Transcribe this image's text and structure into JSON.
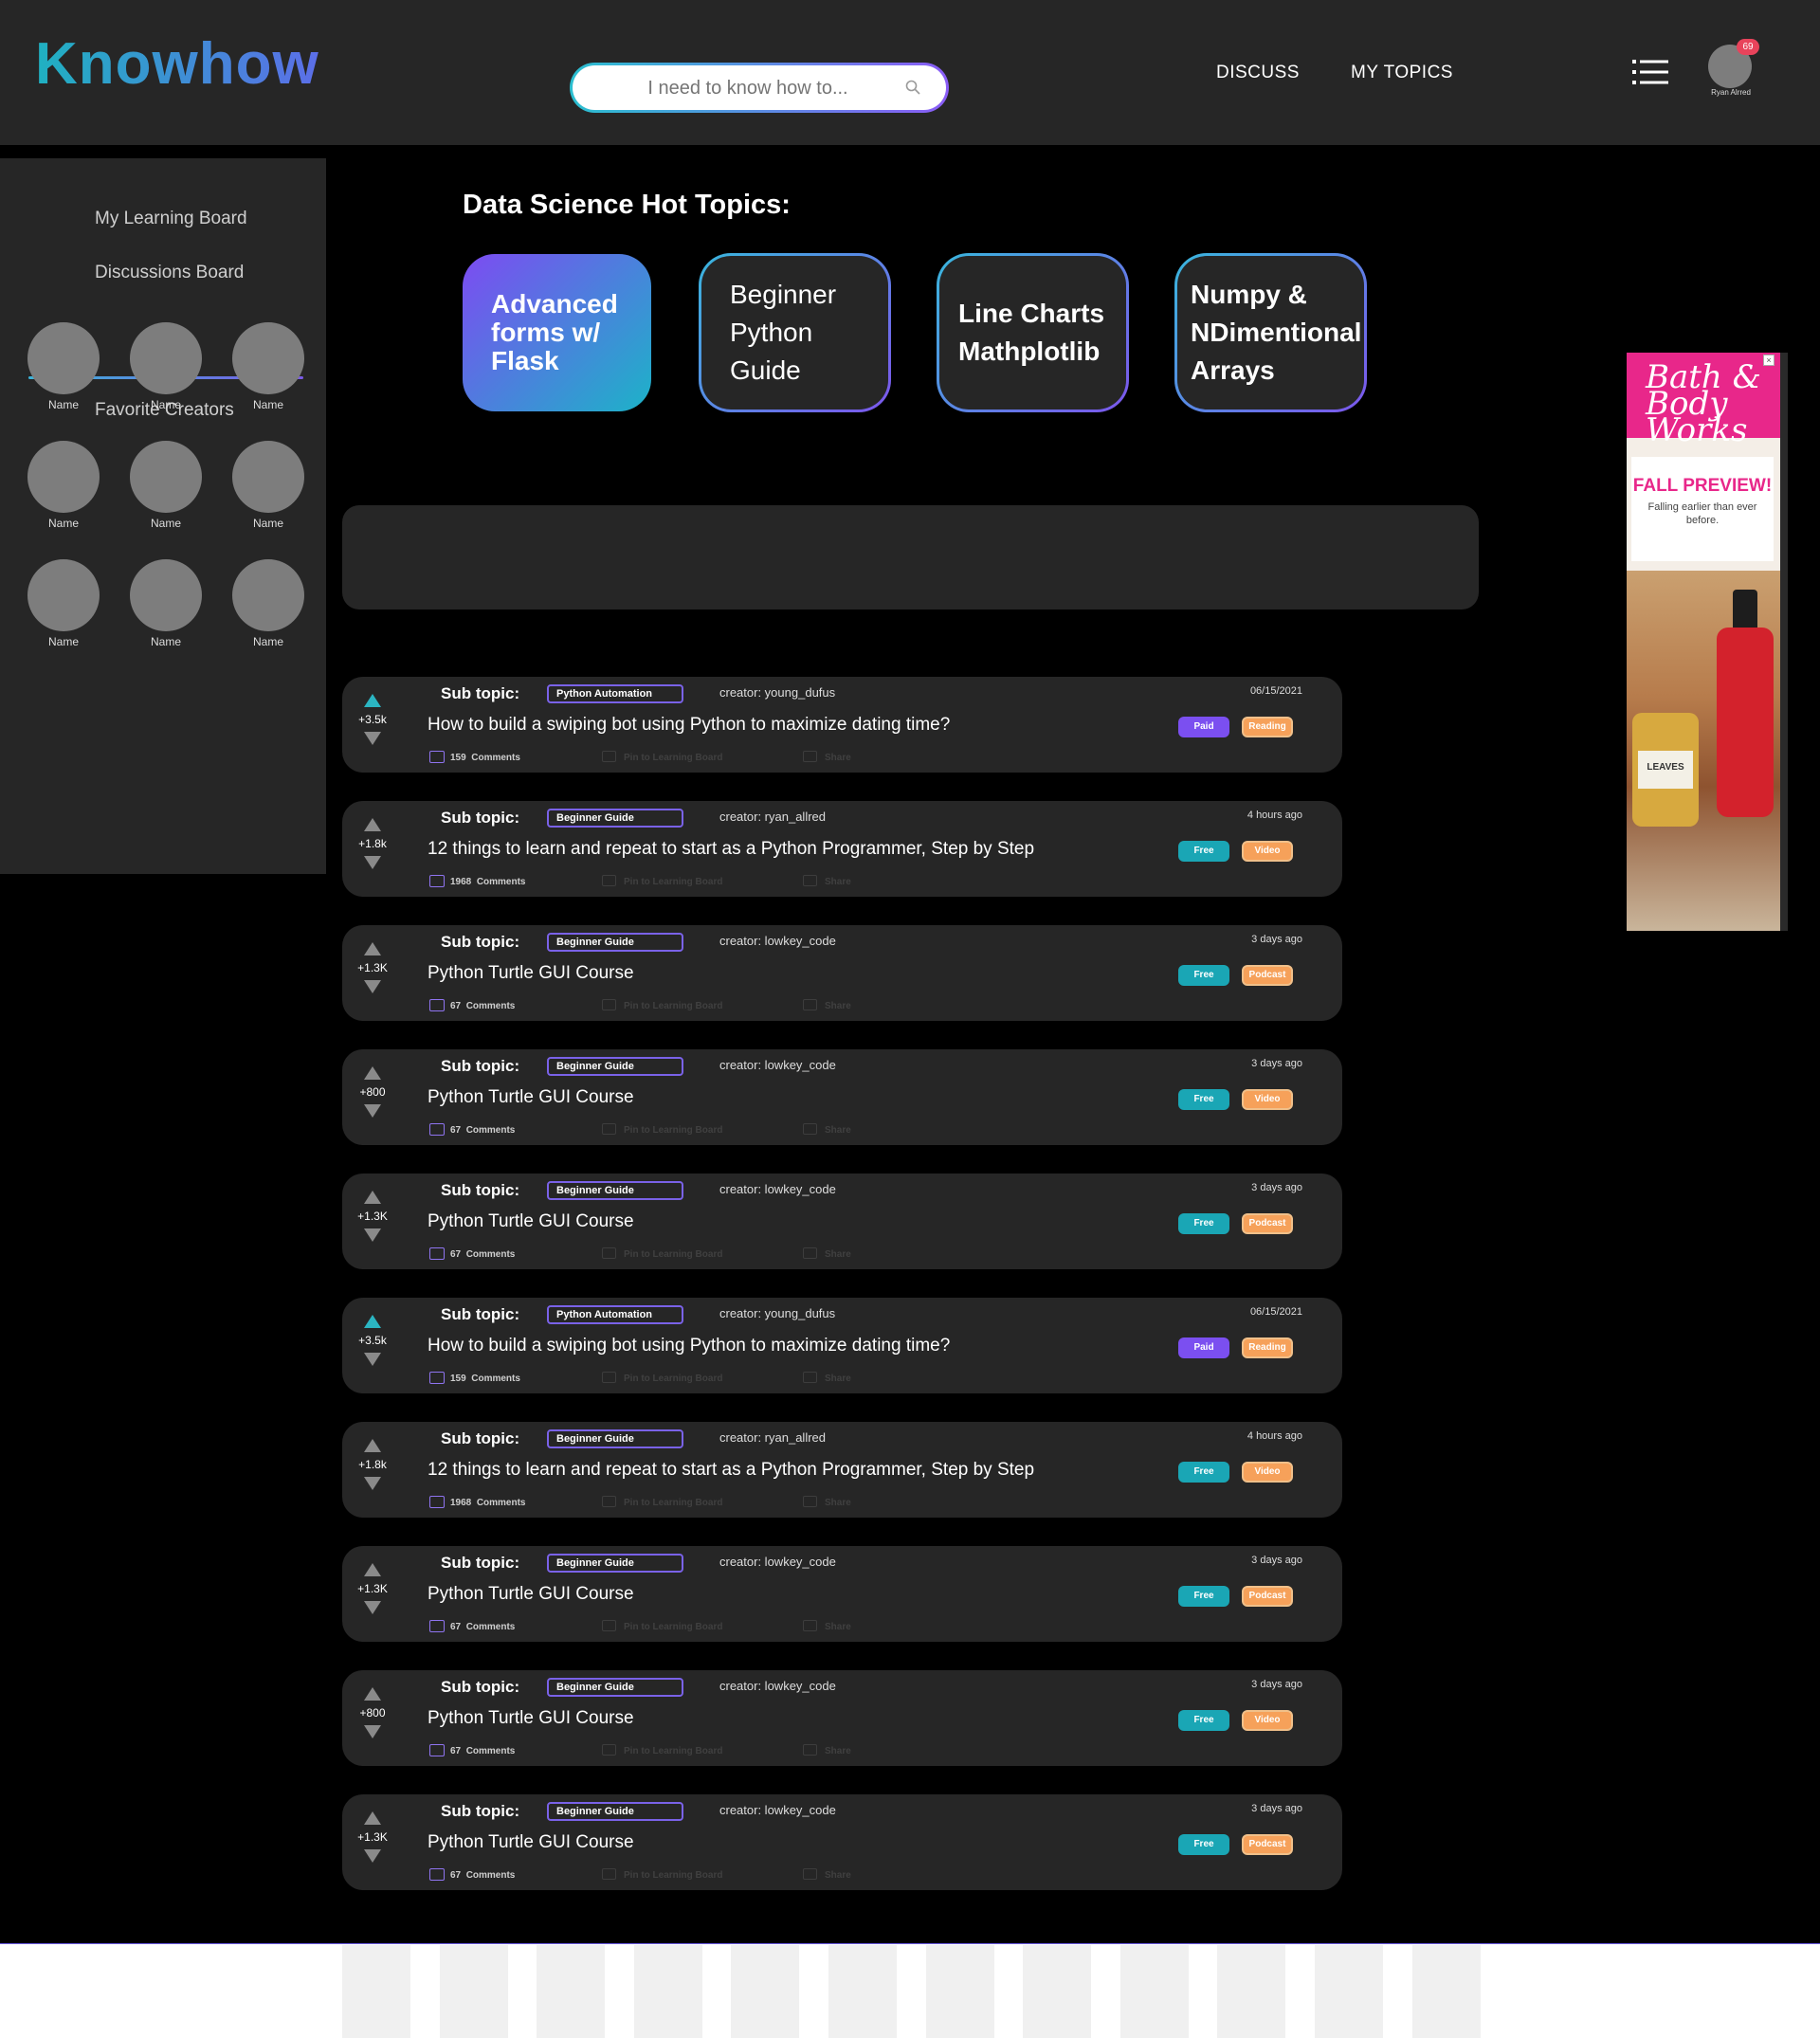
{
  "app": {
    "logo": "Knowhow"
  },
  "search": {
    "placeholder": "I need to know how to..."
  },
  "nav": {
    "discuss": "DISCUSS",
    "my_topics": "MY TOPICS"
  },
  "user": {
    "name": "Ryan Alrred",
    "notifications": "69"
  },
  "sidebar": {
    "links": [
      "My Learning Board",
      "Discussions Board"
    ],
    "favorites_title": "Favorite Creators",
    "creators": [
      "Name",
      "Name",
      "Name",
      "Name",
      "Name",
      "Name",
      "Name",
      "Name",
      "Name"
    ]
  },
  "hot_topics": {
    "title": "Data Science Hot Topics:",
    "tiles": [
      {
        "label": "Advanced\nforms w/\nFlask"
      },
      {
        "label": "Beginner\nPython\nGuide"
      },
      {
        "label": "Line Charts\nMathplotlib"
      },
      {
        "label": "Numpy &\nNDimentional\nArrays"
      }
    ]
  },
  "post_labels": {
    "sub_topic": "Sub topic:",
    "comments_suffix": "Comments",
    "pin": "Pin to Learning Board",
    "share": "Share"
  },
  "posts": [
    {
      "votes": "+3.5k",
      "hot": true,
      "tag": "Python Automation",
      "creator": "creator: young_dufus",
      "date": "06/15/2021",
      "title": "How to build a swiping bot using Python to maximize dating time?",
      "price": "Paid",
      "format": "Reading",
      "comments": "159"
    },
    {
      "votes": "+1.8k",
      "hot": false,
      "tag": "Beginner Guide",
      "creator": "creator: ryan_allred",
      "date": "4 hours ago",
      "title": "12 things to learn and repeat to start as a Python Programmer, Step by Step",
      "price": "Free",
      "format": "Video",
      "comments": "1968"
    },
    {
      "votes": "+1.3K",
      "hot": false,
      "tag": "Beginner Guide",
      "creator": "creator: lowkey_code",
      "date": "3 days ago",
      "title": "Python Turtle GUI Course",
      "price": "Free",
      "format": "Podcast",
      "comments": "67"
    },
    {
      "votes": "+800",
      "hot": false,
      "tag": "Beginner Guide",
      "creator": "creator: lowkey_code",
      "date": "3 days ago",
      "title": "Python Turtle GUI Course",
      "price": "Free",
      "format": "Video",
      "comments": "67"
    },
    {
      "votes": "+1.3K",
      "hot": false,
      "tag": "Beginner Guide",
      "creator": "creator: lowkey_code",
      "date": "3 days ago",
      "title": "Python Turtle GUI Course",
      "price": "Free",
      "format": "Podcast",
      "comments": "67"
    },
    {
      "votes": "+3.5k",
      "hot": true,
      "tag": "Python Automation",
      "creator": "creator: young_dufus",
      "date": "06/15/2021",
      "title": "How to build a swiping bot using Python to maximize dating time?",
      "price": "Paid",
      "format": "Reading",
      "comments": "159"
    },
    {
      "votes": "+1.8k",
      "hot": false,
      "tag": "Beginner Guide",
      "creator": "creator: ryan_allred",
      "date": "4 hours ago",
      "title": "12 things to learn and repeat to start as a Python Programmer, Step by Step",
      "price": "Free",
      "format": "Video",
      "comments": "1968"
    },
    {
      "votes": "+1.3K",
      "hot": false,
      "tag": "Beginner Guide",
      "creator": "creator: lowkey_code",
      "date": "3 days ago",
      "title": "Python Turtle GUI Course",
      "price": "Free",
      "format": "Podcast",
      "comments": "67"
    },
    {
      "votes": "+800",
      "hot": false,
      "tag": "Beginner Guide",
      "creator": "creator: lowkey_code",
      "date": "3 days ago",
      "title": "Python Turtle GUI Course",
      "price": "Free",
      "format": "Video",
      "comments": "67"
    },
    {
      "votes": "+1.3K",
      "hot": false,
      "tag": "Beginner Guide",
      "creator": "creator: lowkey_code",
      "date": "3 days ago",
      "title": "Python Turtle GUI Course",
      "price": "Free",
      "format": "Podcast",
      "comments": "67"
    }
  ],
  "ad": {
    "brand": "Bath & Body Works",
    "headline": "FALL PREVIEW!",
    "sub": "Falling earlier than ever before.",
    "jar_label": "LEAVES"
  },
  "colors": {
    "accent_teal": "#1fb1c1",
    "accent_purple": "#7b4ff0",
    "format_orange": "#f6a15a"
  }
}
